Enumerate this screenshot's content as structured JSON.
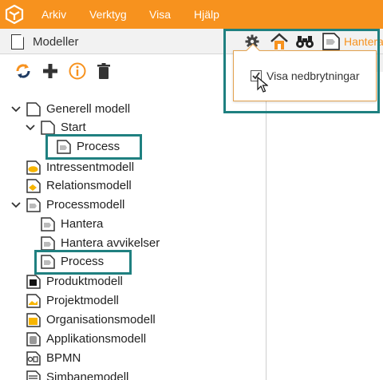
{
  "menubar": {
    "items": [
      "Arkiv",
      "Verktyg",
      "Visa",
      "Hjälp"
    ]
  },
  "left_panel": {
    "title": "Modeller"
  },
  "tree": [
    {
      "label": "Generell modell"
    },
    {
      "label": "Start"
    },
    {
      "label": "Process"
    },
    {
      "label": "Intressentmodell"
    },
    {
      "label": "Relationsmodell"
    },
    {
      "label": "Processmodell"
    },
    {
      "label": "Hantera"
    },
    {
      "label": "Hantera avvikelser"
    },
    {
      "label": "Process"
    },
    {
      "label": "Produktmodell"
    },
    {
      "label": "Projektmodell"
    },
    {
      "label": "Organisationsmodell"
    },
    {
      "label": "Applikationsmodell"
    },
    {
      "label": "BPMN"
    },
    {
      "label": "Simbanemodell"
    }
  ],
  "right_panel": {
    "tab_label": "Hantera"
  },
  "popup": {
    "checkbox_label": "Visa nedbrytningar",
    "checked": true
  },
  "colors": {
    "accent": "#f7921e",
    "highlight": "#1f8080"
  }
}
